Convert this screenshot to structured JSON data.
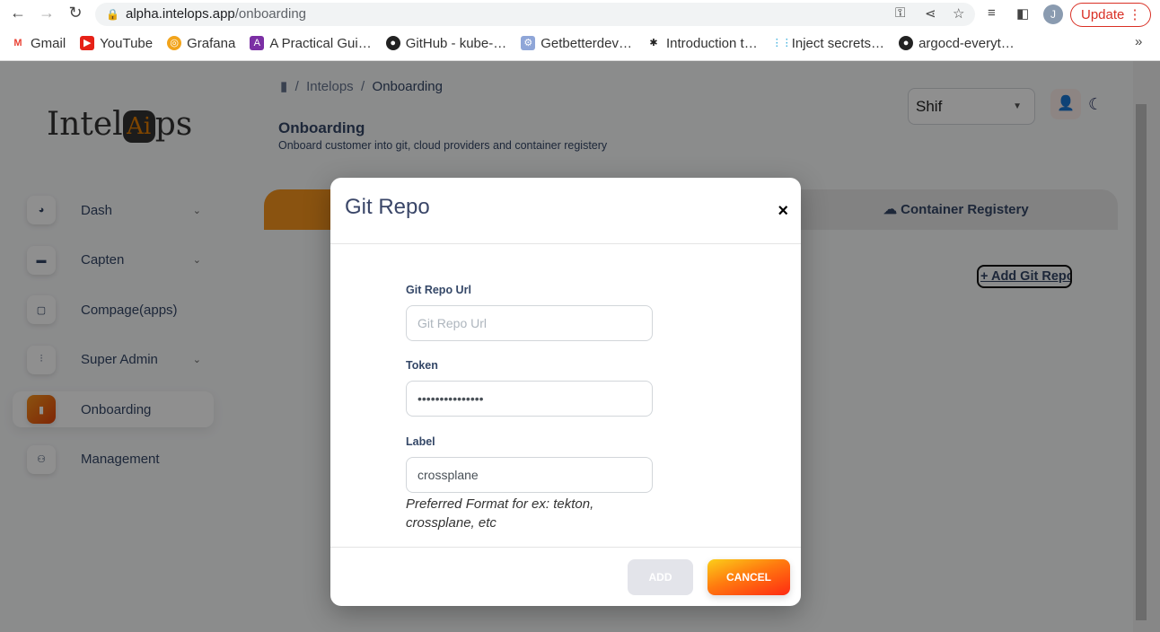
{
  "browser": {
    "url_host": "alpha.intelops.app",
    "url_path": "/onboarding",
    "update_label": "Update",
    "profile_initial": "J",
    "bookmarks": [
      "Gmail",
      "YouTube",
      "Grafana",
      "A Practical Gui…",
      "GitHub - kube-…",
      "Getbetterdev…",
      "Introduction t…",
      "Inject secrets…",
      "argocd-everyt…"
    ],
    "more": "»"
  },
  "logo": {
    "text_left": "Intel",
    "text_mid": "Ai",
    "text_right": "ps"
  },
  "sidebar": {
    "items": [
      {
        "label": "Dash",
        "icon": "pie-chart-icon",
        "chevron": true
      },
      {
        "label": "Capten",
        "icon": "server-icon",
        "chevron": true
      },
      {
        "label": "Compage(apps)",
        "icon": "monitor-icon",
        "chevron": false
      },
      {
        "label": "Super Admin",
        "icon": "sliders-icon",
        "chevron": true
      },
      {
        "label": "Onboarding",
        "icon": "clipboard-icon",
        "chevron": false,
        "active": true
      },
      {
        "label": "Management",
        "icon": "users-icon",
        "chevron": false
      }
    ]
  },
  "breadcrumb": {
    "sep": "/",
    "items": [
      "Intelops",
      "Onboarding"
    ]
  },
  "header": {
    "title": "Onboarding",
    "subtitle": "Onboard customer into git, cloud providers and container registery",
    "org_select": "Shif"
  },
  "tabs": {
    "container_registry": "Container Registery"
  },
  "add_git_repo": "Add Git Repo",
  "modal": {
    "title": "Git Repo",
    "close": "×",
    "fields": [
      {
        "label": "Git Repo Url",
        "placeholder": "Git Repo Url",
        "value": ""
      },
      {
        "label": "Token",
        "value": "•••••••••••••••"
      },
      {
        "label": "Label",
        "value": "crossplane",
        "hint": "Preferred Format for ex: tekton, crossplane, etc"
      }
    ],
    "add": "ADD",
    "cancel": "CANCEL"
  },
  "colors": {
    "accent": "#f7941d",
    "primary_text": "#344767",
    "cancel_gradient": [
      "#fbcf1a",
      "#ff2a12"
    ]
  }
}
